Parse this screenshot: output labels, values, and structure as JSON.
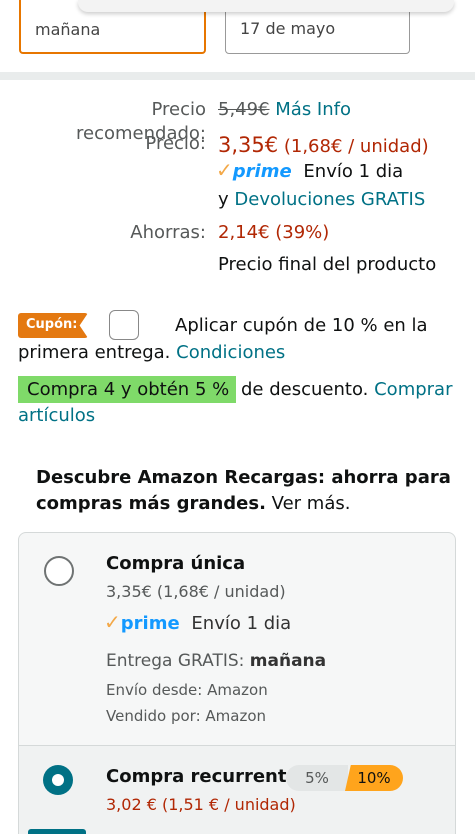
{
  "delivery": {
    "option_left": "mañana",
    "option_right": "17 de mayo"
  },
  "pricing": {
    "recommended_label": "Precio recomendado:",
    "recommended_value": "5,49€",
    "more_info": "Más Info",
    "price_label": "Precio:",
    "price_value": "3,35€",
    "price_unit": "(1,68€ / unidad)",
    "prime_check": "✓",
    "prime_word": "prime",
    "prime_shipping": "Envío 1 dia",
    "returns_prefix": "y",
    "returns_link": "Devoluciones GRATIS",
    "savings_label": "Ahorras:",
    "savings_value": "2,14€ (39%)",
    "final_price_note": "Precio final del producto"
  },
  "coupon": {
    "tag": "Cupón:",
    "text_line1": "Aplicar cupón de 10 % en la",
    "text_line2": "primera entrega.",
    "conditions_link": "Condiciones"
  },
  "promo": {
    "badge": "Compra 4 y obtén 5 %",
    "text": "de descuento.",
    "link_line1": "Comprar",
    "link_line2": "artículos"
  },
  "recargas": {
    "heading_line1": "Descubre Amazon Recargas: ahorra para",
    "heading_line2": "compras más grandes.",
    "see_more": "Ver más.",
    "one_time": {
      "title": "Compra única",
      "price": "3,35€ (1,68€ / unidad)",
      "prime_check": "✓",
      "prime_word": "prime",
      "prime_shipping": "Envío 1 dia",
      "delivery_prefix": "Entrega GRATIS:",
      "delivery_day": "mañana",
      "ships_from": "Envío desde: Amazon",
      "sold_by": "Vendido por: Amazon"
    },
    "recurring": {
      "title": "Compra recurrente",
      "discount_low": "5%",
      "discount_high": "10%",
      "price": "3,02 € (1,51 € / unidad)"
    }
  },
  "colors": {
    "price_red": "#b12704",
    "link_teal": "#007185",
    "prime_blue": "#1399ff",
    "coupon_orange": "#e47911",
    "promo_green": "#7fda69"
  }
}
